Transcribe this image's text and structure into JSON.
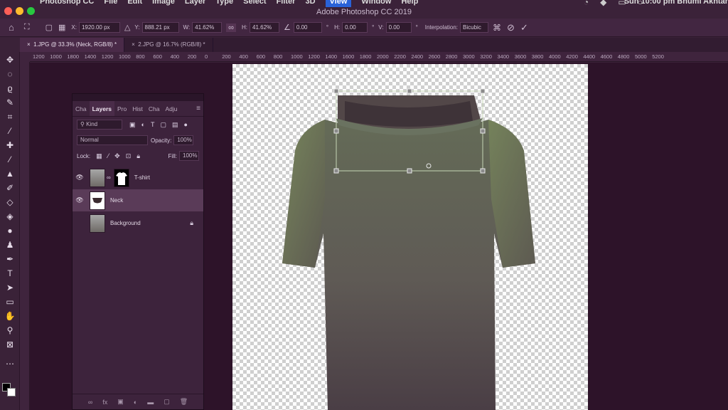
{
  "titlebar": {
    "menu": [
      "Photoshop CC",
      "File",
      "Edit",
      "Image",
      "Layer",
      "Type",
      "Select",
      "Filter",
      "3D",
      "View",
      "Window",
      "Help"
    ],
    "active_menu": "View",
    "title": "Adobe Photoshop CC 2019",
    "clock": "Sun 10:00 pm   Bhumi Akhtar",
    "traffic_colors": [
      "#fe5f57",
      "#febc2e",
      "#28c840"
    ]
  },
  "options": {
    "x_label": "X:",
    "x_value": "1920.00 px",
    "y_label": "Y:",
    "y_value": "888.21 px",
    "w_label": "W:",
    "w_value": "41.62%",
    "h_label": "H:",
    "h_value": "41.62%",
    "angle_value": "0.00",
    "angle_unit": "°",
    "hskew_label": "H:",
    "hskew_value": "0.00",
    "vskew_label": "V:",
    "vskew_value": "0.00",
    "interp_label": "Interpolation:",
    "interp_value": "Bicubic"
  },
  "tabs": [
    {
      "label": "1.JPG @ 33.3% (Neck, RGB/8) *",
      "active": true
    },
    {
      "label": "2.JPG @ 16.7% (RGB/8) *",
      "active": false
    }
  ],
  "ruler": [
    "1200",
    "1000",
    "1800",
    "1400",
    "1200",
    "1000",
    "800",
    "600",
    "400",
    "200",
    "0",
    "200",
    "400",
    "600",
    "800",
    "1000",
    "1200",
    "1400",
    "1600",
    "1800",
    "2000",
    "2200",
    "2400",
    "2600",
    "2800",
    "3000",
    "3200",
    "3400",
    "3600",
    "3800",
    "4000",
    "4200",
    "4400",
    "4600",
    "4800",
    "5000",
    "5200"
  ],
  "layers_panel": {
    "tabs": [
      "Cha",
      "Layers",
      "Pro",
      "Hist",
      "Cha",
      "Adju"
    ],
    "active_tab": "Layers",
    "search_placeholder": "Kind",
    "blend_mode": "Normal",
    "opacity_label": "Opacity:",
    "opacity_value": "100%",
    "lock_label": "Lock:",
    "fill_label": "Fill:",
    "fill_value": "100%",
    "layers": [
      {
        "name": "T-shirt",
        "visible": true,
        "has_mask": true,
        "selected": false
      },
      {
        "name": "Neck",
        "visible": true,
        "has_mask": false,
        "selected": true
      },
      {
        "name": "Background",
        "visible": false,
        "has_mask": false,
        "selected": false,
        "locked": true
      }
    ]
  },
  "colors": {
    "shirt": "#63614f",
    "shirt_highlight": "#7b8a5e",
    "transform_box": "#c6d6b6"
  }
}
